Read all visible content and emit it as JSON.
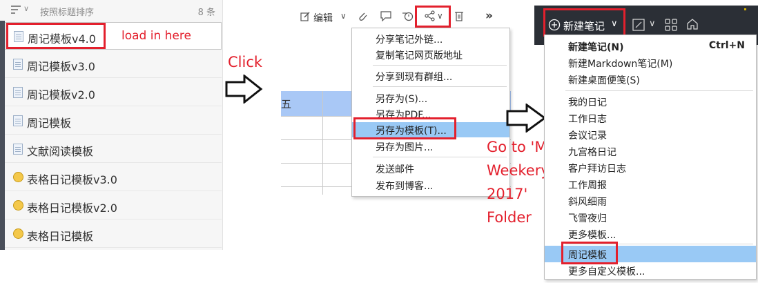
{
  "panel1": {
    "sort_label": "按照标题排序",
    "sort_chevron": "∨",
    "count": "8 条",
    "notes": [
      {
        "label": "周记模板v4.0",
        "icon": "document-icon"
      },
      {
        "label": "周记模板v3.0",
        "icon": "document-icon"
      },
      {
        "label": "周记模板v2.0",
        "icon": "document-icon"
      },
      {
        "label": "周记模板",
        "icon": "document-icon"
      },
      {
        "label": "文献阅读模板",
        "icon": "document-icon"
      },
      {
        "label": "表格日记模板v3.0",
        "icon": "smiley-icon"
      },
      {
        "label": "表格日记模板v2.0",
        "icon": "smiley-icon"
      },
      {
        "label": "表格日记模板",
        "icon": "smiley-icon"
      }
    ],
    "annotation": "load in here"
  },
  "click_label": "Click",
  "panel2": {
    "toolbar": {
      "edit_label": "编辑",
      "chevron": "∨",
      "more": "»"
    },
    "table_cell": "五",
    "share_menu": [
      {
        "label": "分享笔记外链..."
      },
      {
        "label": "复制笔记网页版地址"
      },
      {
        "label": "分享到现有群组..."
      },
      {
        "label": "另存为(S)..."
      },
      {
        "label": "另存为PDF..."
      },
      {
        "label": "另存为模板(T)..."
      },
      {
        "label": "另存为图片..."
      },
      {
        "label": "发送邮件"
      },
      {
        "label": "发布到博客..."
      }
    ]
  },
  "goto_annotation": [
    "Go to 'My",
    "Weekery/",
    "2017'",
    "Folder"
  ],
  "panel3": {
    "new_note_label": "新建笔记",
    "new_note_chevron": "∨",
    "new_menu": [
      {
        "label": "新建笔记(N)",
        "shortcut": "Ctrl+N"
      },
      {
        "label": "新建Markdown笔记(M)",
        "shortcut": ""
      },
      {
        "label": "新建桌面便笺(S)",
        "shortcut": ""
      },
      {
        "label": "我的日记",
        "shortcut": ""
      },
      {
        "label": "工作日志",
        "shortcut": ""
      },
      {
        "label": "会议记录",
        "shortcut": ""
      },
      {
        "label": "九宫格日记",
        "shortcut": ""
      },
      {
        "label": "客户拜访日志",
        "shortcut": ""
      },
      {
        "label": "工作周报",
        "shortcut": ""
      },
      {
        "label": "斜风细雨",
        "shortcut": ""
      },
      {
        "label": "飞雪夜归",
        "shortcut": ""
      },
      {
        "label": "更多模板...",
        "shortcut": ""
      },
      {
        "label": "周记模板",
        "shortcut": ""
      },
      {
        "label": "更多自定义模板...",
        "shortcut": ""
      }
    ]
  },
  "colors": {
    "annotation_red": "#e3202d",
    "highlight_blue": "#99c9f5",
    "toolbar_dark": "#2b2f36"
  }
}
